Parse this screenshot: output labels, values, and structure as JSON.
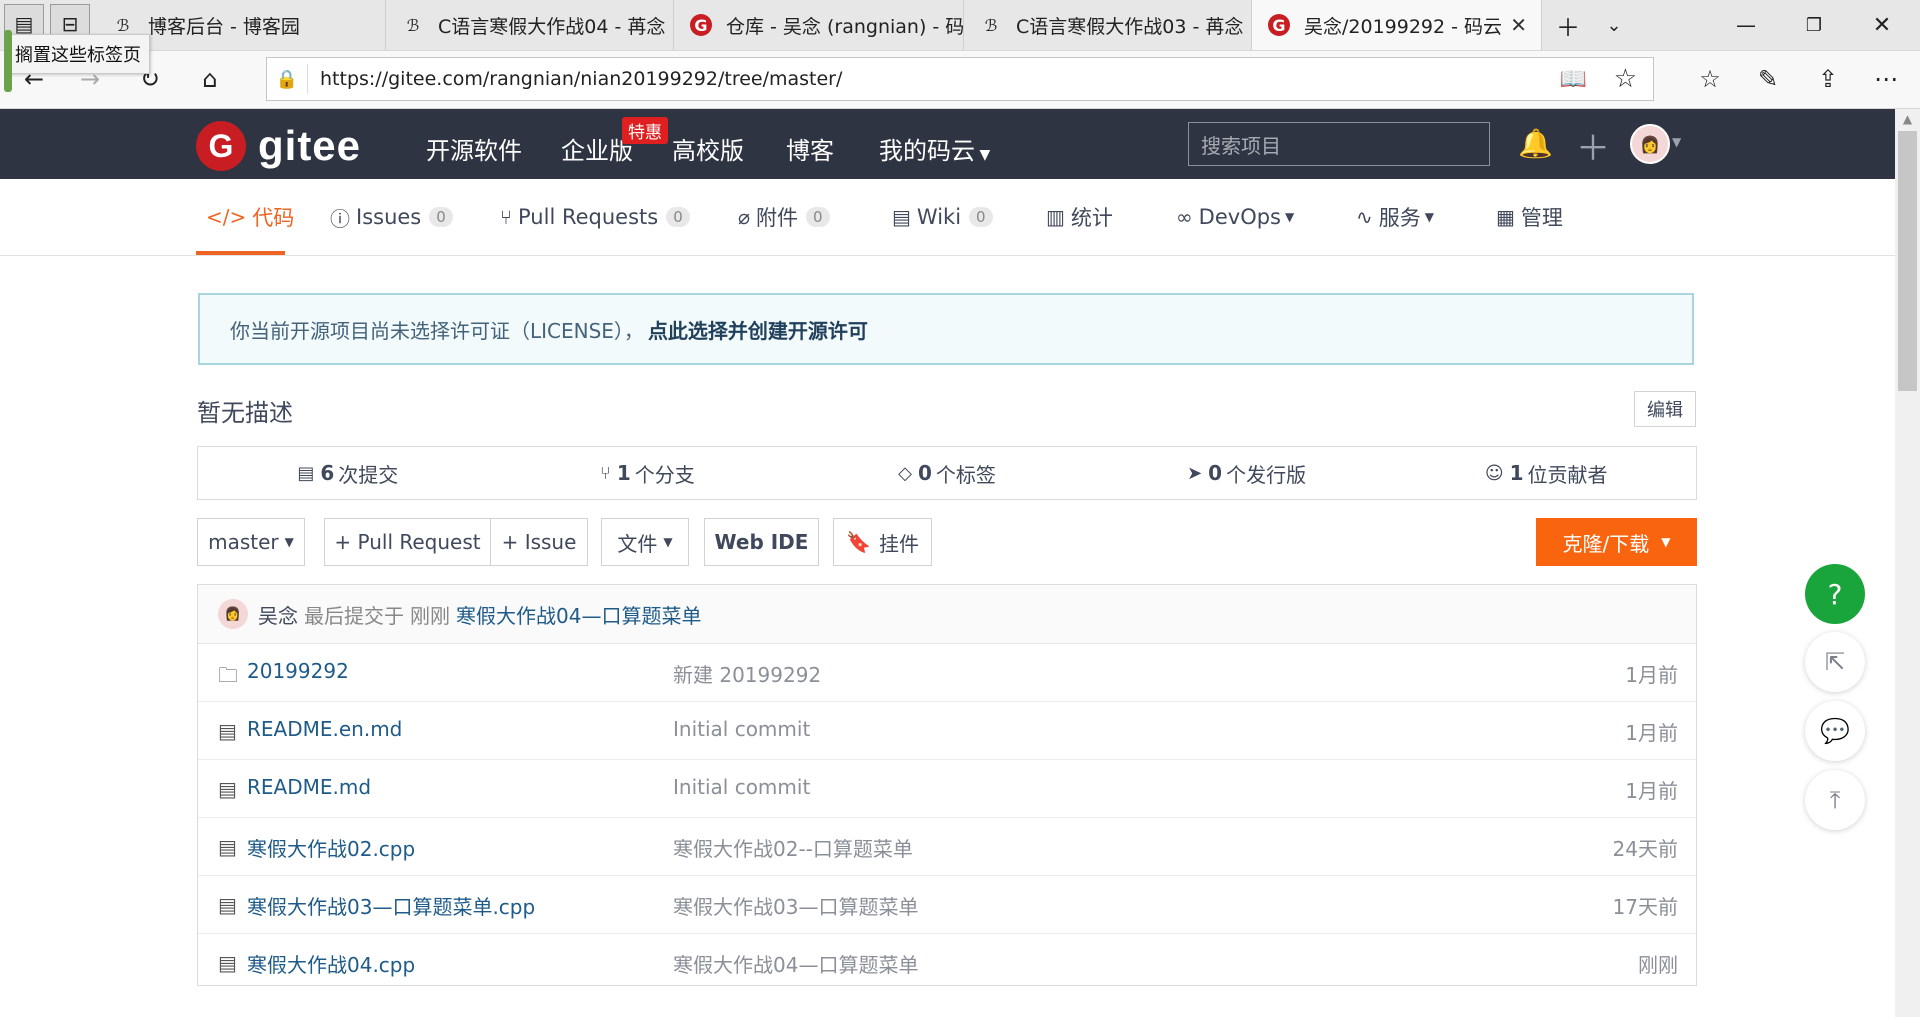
{
  "browser": {
    "tooltip": "搁置这些标签页",
    "tabs": [
      {
        "title": "博客后台 - 博客园"
      },
      {
        "title": "C语言寒假大作战04 - 苒念"
      },
      {
        "title": "仓库 - 吴念 (rangnian) - 码"
      },
      {
        "title": "C语言寒假大作战03 - 苒念"
      },
      {
        "title": "吴念/20199292 - 码云"
      }
    ],
    "url": "https://gitee.com/rangnian/nian20199292/tree/master/"
  },
  "header": {
    "logo_text": "gitee",
    "logo_letter": "G",
    "nav": [
      "开源软件",
      "企业版",
      "高校版",
      "博客",
      "我的码云"
    ],
    "hot_badge": "特惠",
    "search_placeholder": "搜索项目"
  },
  "repo_tabs": [
    {
      "label": "代码"
    },
    {
      "label": "Issues",
      "count": "0"
    },
    {
      "label": "Pull Requests",
      "count": "0"
    },
    {
      "label": "附件",
      "count": "0"
    },
    {
      "label": "Wiki",
      "count": "0"
    },
    {
      "label": "统计"
    },
    {
      "label": "DevOps"
    },
    {
      "label": "服务"
    },
    {
      "label": "管理"
    }
  ],
  "license_notice": {
    "text": "你当前开源项目尚未选择许可证（LICENSE），",
    "link": "点此选择并创建开源许可"
  },
  "description": "暂无描述",
  "edit_label": "编辑",
  "stats": [
    {
      "num": "6",
      "label": "次提交"
    },
    {
      "num": "1",
      "label": "个分支"
    },
    {
      "num": "0",
      "label": "个标签"
    },
    {
      "num": "0",
      "label": "个发行版"
    },
    {
      "num": "1",
      "label": "位贡献者"
    }
  ],
  "toolbar": {
    "branch": "master",
    "pull_request": "+ Pull Request",
    "issue": "+ Issue",
    "file": "文件",
    "web_ide": "Web IDE",
    "widget": "挂件",
    "clone": "克隆/下载"
  },
  "last_commit": {
    "author": "吴念",
    "text": "最后提交于",
    "time": "刚刚",
    "message": "寒假大作战04—口算题菜单"
  },
  "files": [
    {
      "name": "20199292",
      "type": "folder",
      "message": "新建 20199292",
      "time": "1月前"
    },
    {
      "name": "README.en.md",
      "type": "file",
      "message": "Initial commit",
      "time": "1月前"
    },
    {
      "name": "README.md",
      "type": "file",
      "message": "Initial commit",
      "time": "1月前"
    },
    {
      "name": "寒假大作战02.cpp",
      "type": "file",
      "message": "寒假大作战02--口算题菜单",
      "time": "24天前"
    },
    {
      "name": "寒假大作战03—口算题菜单.cpp",
      "type": "file",
      "message": "寒假大作战03—口算题菜单",
      "time": "17天前"
    },
    {
      "name": "寒假大作战04.cpp",
      "type": "file",
      "message": "寒假大作战04—口算题菜单",
      "time": "刚刚"
    }
  ],
  "fab": {
    "help": "?"
  },
  "colors": {
    "accent": "#f06421",
    "header_bg": "#2e3441",
    "clone_btn": "#f9640f",
    "help_fab": "#19a53b"
  }
}
